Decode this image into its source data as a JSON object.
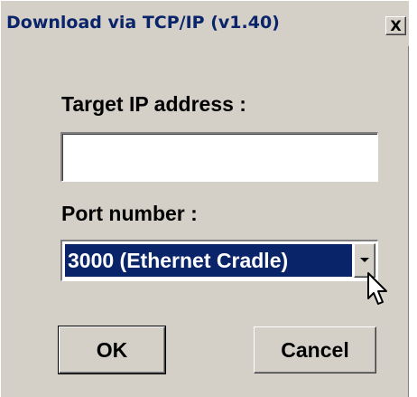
{
  "window": {
    "title": "Download via TCP/IP (v1.40)",
    "close_label": "X"
  },
  "form": {
    "ip_label": "Target IP address :",
    "ip_value": "",
    "port_label": "Port number :",
    "port_value": "3000 (Ethernet Cradle)"
  },
  "buttons": {
    "ok_label": "OK",
    "cancel_label": "Cancel"
  },
  "icons": {
    "close": "close-icon",
    "dropdown": "chevron-down-icon",
    "cursor": "mouse-pointer-icon"
  },
  "colors": {
    "face": "#d4d0c8",
    "selection": "#0a246a",
    "title_text": "#0a246a"
  }
}
